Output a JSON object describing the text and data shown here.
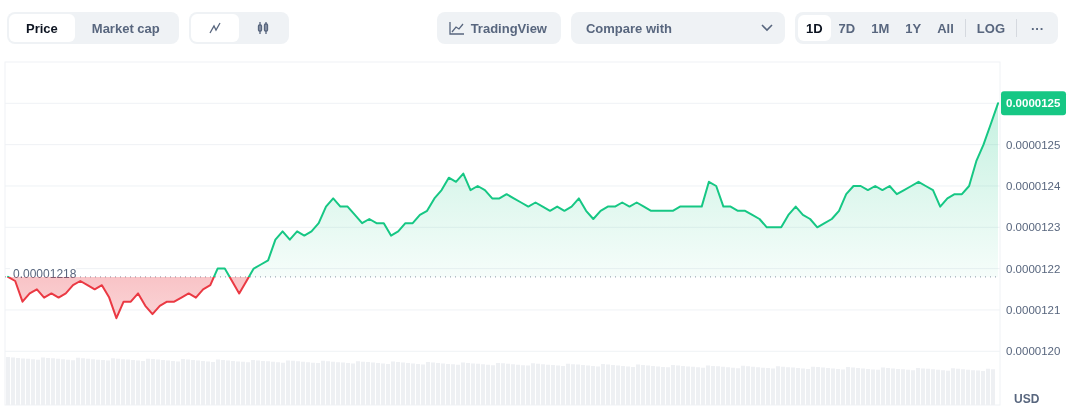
{
  "chart_type_tabs": [
    {
      "label": "Price",
      "selected": true
    },
    {
      "label": "Market cap",
      "selected": false
    }
  ],
  "view_tabs": [
    {
      "kind": "line",
      "selected": true
    },
    {
      "kind": "candle",
      "selected": false
    }
  ],
  "tradingview_button": {
    "label": "TradingView"
  },
  "compare": {
    "placeholder": "Compare with"
  },
  "ranges": [
    {
      "label": "1D",
      "selected": true
    },
    {
      "label": "7D",
      "selected": false
    },
    {
      "label": "1M",
      "selected": false
    },
    {
      "label": "1Y",
      "selected": false
    },
    {
      "label": "All",
      "selected": false
    }
  ],
  "log_button": {
    "label": "LOG"
  },
  "more_button": {
    "label": "···"
  },
  "chart": {
    "current_price": "0.0000125",
    "currency": "USD",
    "chart_data": {
      "type": "area",
      "grid": true,
      "ylim": [
        1.187e-05,
        1.27e-05
      ],
      "yticks": [
        {
          "value": 1.2e-05,
          "label": "0.0000120"
        },
        {
          "value": 1.21e-05,
          "label": "0.0000121"
        },
        {
          "value": 1.22e-05,
          "label": "0.0000122"
        },
        {
          "value": 1.23e-05,
          "label": "0.0000123"
        },
        {
          "value": 1.24e-05,
          "label": "0.0000124"
        },
        {
          "value": 1.25e-05,
          "label": "0.0000125"
        }
      ],
      "ref_lines": [
        {
          "axis": "y",
          "value": 1.218e-05,
          "label": "0.00001218"
        }
      ],
      "series": [
        {
          "color": "#16c784",
          "values": [
            1.218e-05,
            1.217e-05,
            1.212e-05,
            1.214e-05,
            1.215e-05,
            1.213e-05,
            1.214e-05,
            1.213e-05,
            1.214e-05,
            1.216e-05,
            1.217e-05,
            1.216e-05,
            1.215e-05,
            1.216e-05,
            1.213e-05,
            1.208e-05,
            1.212e-05,
            1.212e-05,
            1.214e-05,
            1.211e-05,
            1.209e-05,
            1.211e-05,
            1.212e-05,
            1.212e-05,
            1.213e-05,
            1.214e-05,
            1.213e-05,
            1.215e-05,
            1.216e-05,
            1.22e-05,
            1.22e-05,
            1.217e-05,
            1.214e-05,
            1.217e-05,
            1.22e-05,
            1.221e-05,
            1.222e-05,
            1.227e-05,
            1.229e-05,
            1.227e-05,
            1.229e-05,
            1.228e-05,
            1.229e-05,
            1.231e-05,
            1.235e-05,
            1.237e-05,
            1.235e-05,
            1.235e-05,
            1.233e-05,
            1.231e-05,
            1.232e-05,
            1.231e-05,
            1.231e-05,
            1.228e-05,
            1.229e-05,
            1.231e-05,
            1.231e-05,
            1.233e-05,
            1.234e-05,
            1.237e-05,
            1.239e-05,
            1.242e-05,
            1.241e-05,
            1.243e-05,
            1.239e-05,
            1.24e-05,
            1.239e-05,
            1.237e-05,
            1.237e-05,
            1.238e-05,
            1.237e-05,
            1.236e-05,
            1.235e-05,
            1.236e-05,
            1.235e-05,
            1.234e-05,
            1.235e-05,
            1.234e-05,
            1.235e-05,
            1.237e-05,
            1.234e-05,
            1.232e-05,
            1.234e-05,
            1.235e-05,
            1.235e-05,
            1.236e-05,
            1.235e-05,
            1.236e-05,
            1.235e-05,
            1.234e-05,
            1.234e-05,
            1.234e-05,
            1.234e-05,
            1.235e-05,
            1.235e-05,
            1.235e-05,
            1.235e-05,
            1.241e-05,
            1.24e-05,
            1.235e-05,
            1.235e-05,
            1.234e-05,
            1.234e-05,
            1.233e-05,
            1.232e-05,
            1.23e-05,
            1.23e-05,
            1.23e-05,
            1.233e-05,
            1.235e-05,
            1.233e-05,
            1.232e-05,
            1.23e-05,
            1.231e-05,
            1.232e-05,
            1.234e-05,
            1.238e-05,
            1.24e-05,
            1.24e-05,
            1.239e-05,
            1.24e-05,
            1.239e-05,
            1.24e-05,
            1.238e-05,
            1.239e-05,
            1.24e-05,
            1.241e-05,
            1.24e-05,
            1.239e-05,
            1.235e-05,
            1.237e-05,
            1.238e-05,
            1.238e-05,
            1.24e-05,
            1.246e-05,
            1.25e-05,
            1.255e-05,
            1.26e-05
          ]
        }
      ]
    }
  }
}
